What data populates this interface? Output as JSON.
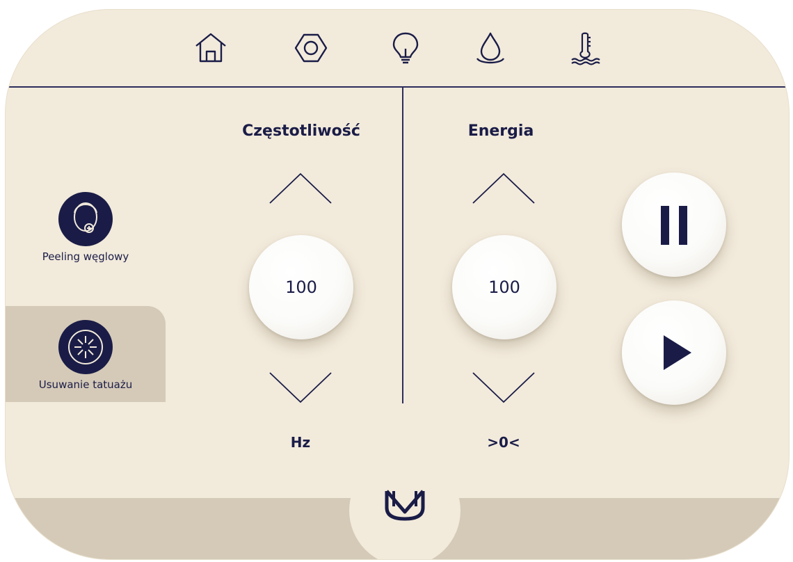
{
  "nav": {
    "items": [
      {
        "icon": "home-icon"
      },
      {
        "icon": "hex-nut-icon"
      },
      {
        "icon": "light-bulb-icon"
      },
      {
        "icon": "water-drop-icon"
      },
      {
        "icon": "thermometer-water-icon"
      }
    ]
  },
  "modes": {
    "items": [
      {
        "label": "Peeling węglowy",
        "icon": "face-peel-icon",
        "selected": false
      },
      {
        "label": "Usuwanie tatuażu",
        "icon": "tattoo-laser-icon",
        "selected": true
      }
    ]
  },
  "frequency": {
    "title": "Częstotliwość",
    "value": "100",
    "unit": "Hz"
  },
  "energy": {
    "title": "Energia",
    "value": "100",
    "unit": ">0<"
  },
  "controls": {
    "pause_icon": "pause-icon",
    "play_icon": "play-icon"
  },
  "brand": {
    "logo": "M-logo",
    "colors": {
      "background": "#f2eadb",
      "band": "#d5cab8",
      "ink": "#1a1c47"
    }
  }
}
